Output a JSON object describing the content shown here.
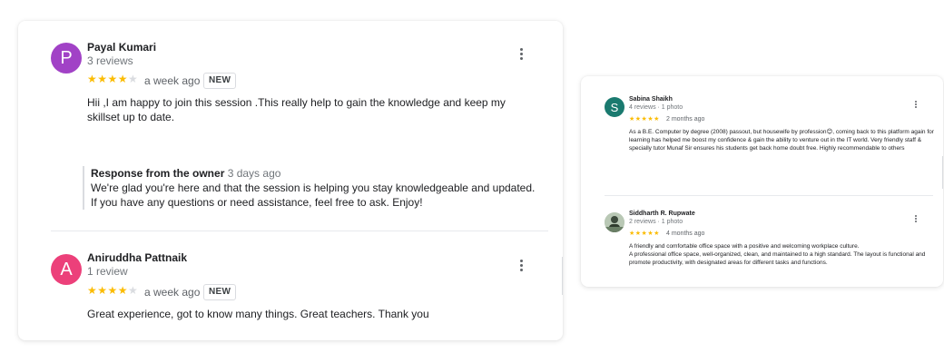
{
  "left_reviews": [
    {
      "initial": "P",
      "avatar_color": "#a142c6",
      "name": "Payal Kumari",
      "subtitle": "3 reviews",
      "stars_filled": "★★★★",
      "stars_empty": "★",
      "rating": 4,
      "time": "a week ago",
      "badge": "NEW",
      "text": "Hii ,I am happy to join this session .This really help to gain the knowledge and keep my skillset up to date.",
      "owner_label": "Response from the owner",
      "owner_time": "3 days ago",
      "owner_text": "We're glad you're here and that the session is helping you stay knowledgeable and updated. If you have any questions or need assistance, feel free to ask. Enjoy!"
    },
    {
      "initial": "A",
      "avatar_color": "#ec407a",
      "name": "Aniruddha Pattnaik",
      "subtitle": "1 review",
      "stars_filled": "★★★★",
      "stars_empty": "★",
      "rating": 4,
      "time": "a week ago",
      "badge": "NEW",
      "text": "Great experience, got to know many things. Great teachers. Thank you"
    }
  ],
  "right_reviews": [
    {
      "initial": "S",
      "avatar_color": "#1a7a6f",
      "name": "Sabina Shaikh",
      "subtitle": "4 reviews · 1 photo",
      "stars": "★★★★★",
      "rating": 5,
      "time": "2 months ago",
      "text": "As a B.E. Computer by degree (2008) passout, but housewife by profession😊, coming back to this platform again for learning has helped me boost my confidence & gain the ability to venture out in the IT world. Very friendly staff & specially tutor Munaf Sir ensures his students get back home doubt free. Highly recommendable to others"
    },
    {
      "name": "Siddharth R. Rupwate",
      "subtitle": "2 reviews · 1 photo",
      "stars": "★★★★★",
      "rating": 5,
      "time": "4 months ago",
      "text_line1": "A friendly and comfortable office space with a positive and welcoming workplace culture.",
      "text_line2": "A professional office space, well-organized, clean, and maintained to a high standard. The layout is functional and promote productivity, with designated areas for different tasks and functions."
    }
  ],
  "colors": {
    "star": "#fbbc04",
    "star_empty": "#dadce0",
    "subtext": "#70757a"
  },
  "icons": [
    "kebab-menu-icon",
    "star-icon",
    "profile-photo"
  ]
}
